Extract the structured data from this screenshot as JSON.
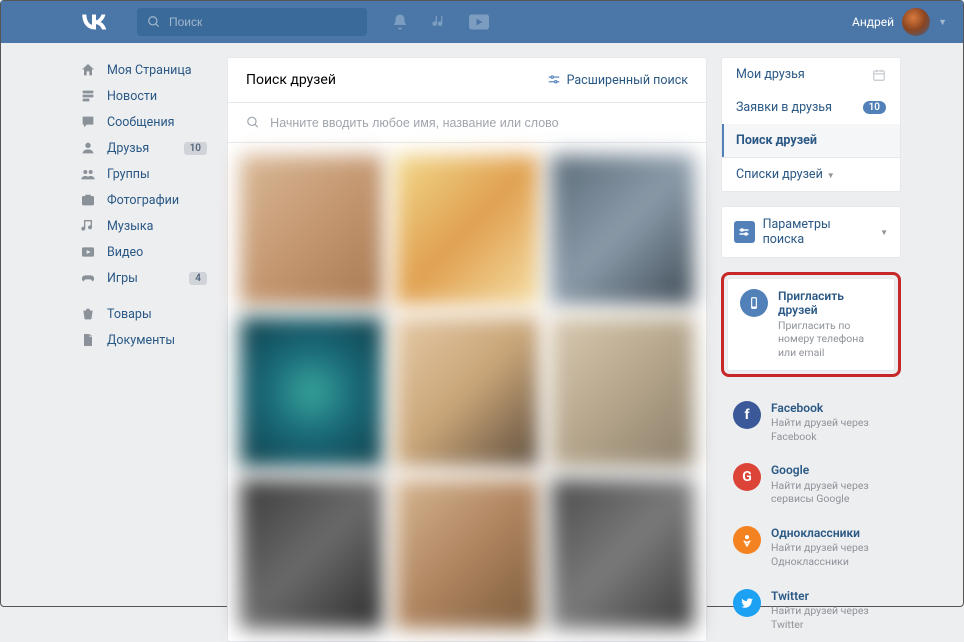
{
  "header": {
    "search_placeholder": "Поиск",
    "user_name": "Андрей"
  },
  "nav": [
    {
      "icon": "home",
      "label": "Моя Страница"
    },
    {
      "icon": "news",
      "label": "Новости"
    },
    {
      "icon": "msg",
      "label": "Сообщения"
    },
    {
      "icon": "friends",
      "label": "Друзья",
      "badge": "10"
    },
    {
      "icon": "groups",
      "label": "Группы"
    },
    {
      "icon": "photos",
      "label": "Фотографии"
    },
    {
      "icon": "music",
      "label": "Музыка"
    },
    {
      "icon": "video",
      "label": "Видео"
    },
    {
      "icon": "games",
      "label": "Игры",
      "badge": "4"
    }
  ],
  "nav2": [
    {
      "icon": "market",
      "label": "Товары"
    },
    {
      "icon": "docs",
      "label": "Документы"
    }
  ],
  "center": {
    "title": "Поиск друзей",
    "advanced": "Расширенный поиск",
    "placeholder": "Начните вводить любое имя, название или слово"
  },
  "tabs": {
    "my_friends": "Мои друзья",
    "requests": "Заявки в друзья",
    "requests_badge": "10",
    "search": "Поиск друзей",
    "lists": "Списки друзей"
  },
  "params": {
    "title": "Параметры поиска"
  },
  "import": {
    "invite": {
      "title": "Пригласить друзей",
      "sub": "Пригласить по номеру телефона или email"
    },
    "facebook": {
      "title": "Facebook",
      "sub": "Найти друзей через Facebook"
    },
    "google": {
      "title": "Google",
      "sub": "Найти друзей через сервисы Google"
    },
    "ok": {
      "title": "Одноклассники",
      "sub": "Найти друзей через Одноклассники"
    },
    "twitter": {
      "title": "Twitter",
      "sub": "Найти друзей через Twitter"
    }
  },
  "tiles": [
    "linear-gradient(135deg,#d9b896,#c49770,#a87952)",
    "linear-gradient(135deg,#f2d98c,#e0a050,#f5dfa5)",
    "linear-gradient(135deg,#5a6b78,#8a9aa8,#3d4a55)",
    "radial-gradient(circle,#3aa99a 0%,#1a6b7b 40%,#0d3a45 100%)",
    "linear-gradient(135deg,#e5c9a5,#c9a578,#5a4a3a)",
    "linear-gradient(135deg,#d8c9b0,#b5a68c,#8a7d68)",
    "linear-gradient(135deg,#3a3a3a,#6a6a6a,#2a2a2a)",
    "linear-gradient(135deg,#d5b590,#b08560,#7a5a3a)",
    "linear-gradient(135deg,#4a4a4a,#7a7a7a,#3a3a3a)"
  ]
}
